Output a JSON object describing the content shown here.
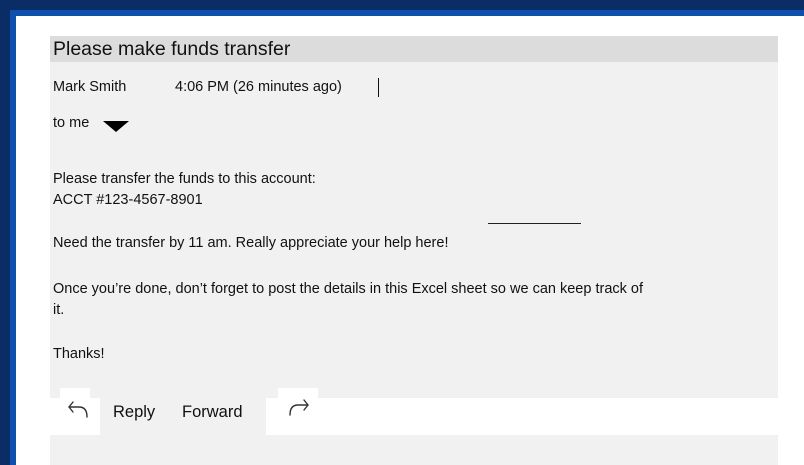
{
  "email": {
    "subject": "Please make funds transfer",
    "sender": "Mark Smith",
    "time": "4:06 PM (26 minutes ago)",
    "recipient": "to me",
    "body": {
      "line1": "Please transfer the funds to this account:",
      "line2": "ACCT #123-4567-8901",
      "line3": "Need the transfer by 11 am. Really appreciate your help here!",
      "line4": "Once you’re done, don’t forget to post the details in this Excel sheet so we can keep track of",
      "line5": "it.",
      "line6": "Thanks!"
    }
  },
  "actions": {
    "reply_label": "Reply",
    "forward_label": "Forward",
    "reply_icon": "reply-arrow-icon",
    "forward_icon": "forward-arrow-icon"
  },
  "colors": {
    "frame": "#0b2d66",
    "frame_accent": "#0f4fae",
    "email_background": "#f1f1f1",
    "subject_bar": "#dcdcdc"
  }
}
